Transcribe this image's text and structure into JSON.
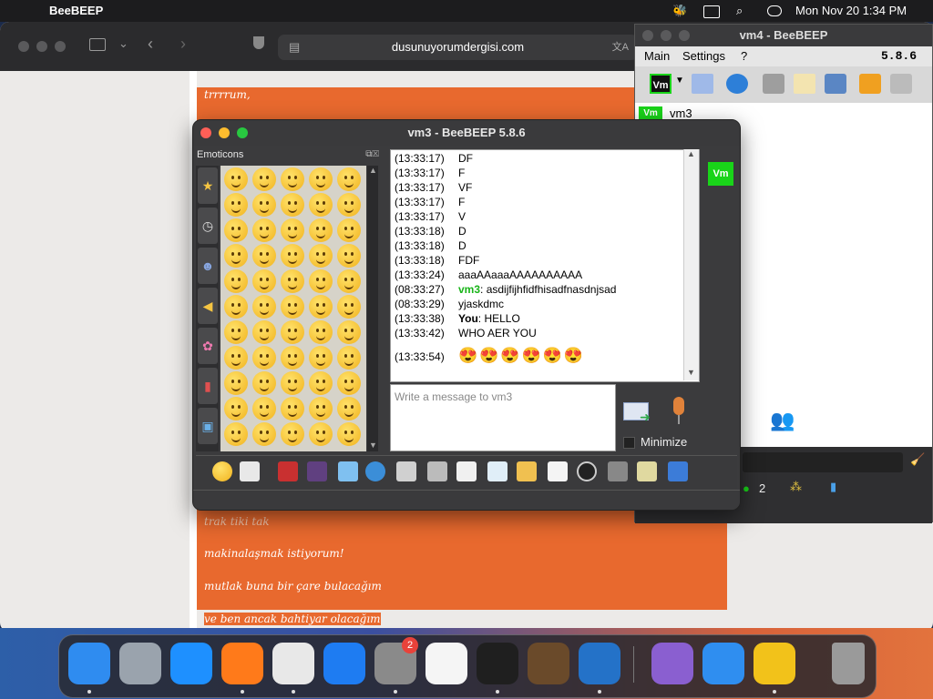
{
  "menubar": {
    "app_name": "BeeBEEP",
    "clock": "Mon Nov 20  1:34 PM"
  },
  "safari": {
    "url": "dusunuyorumdergisi.com",
    "poem_lines": [
      "trrrrum,",
      "trak tiki tak",
      "makinalaşmak istiyorum!",
      "mutlak buna bir çare bulacağım",
      "ve ben ancak bahtiyar olacağım"
    ]
  },
  "vm4": {
    "title": "vm4 - BeeBEEP",
    "menu": [
      "Main",
      "Settings",
      "?"
    ],
    "version": "5.8.6",
    "user": "vm3",
    "user_badge": "Vm",
    "toolbar_badge": "Vm",
    "status_count": "2"
  },
  "vm3": {
    "title": "vm3 - BeeBEEP 5.8.6",
    "emoticons_title": "Emoticons",
    "user_badge": "Vm",
    "chat": [
      {
        "time": "(13:33:17)",
        "text": "DF"
      },
      {
        "time": "(13:33:17)",
        "text": "F"
      },
      {
        "time": "(13:33:17)",
        "text": "VF"
      },
      {
        "time": "(13:33:17)",
        "text": "F"
      },
      {
        "time": "(13:33:17)",
        "text": "V"
      },
      {
        "time": "(13:33:18)",
        "text": "D"
      },
      {
        "time": "(13:33:18)",
        "text": "D"
      },
      {
        "time": "(13:33:18)",
        "text": "FDF"
      },
      {
        "time": "(13:33:24)",
        "text": "aaaAAaaaAAAAAAAAAA"
      },
      {
        "time": "(08:33:27)",
        "sender": "vm3",
        "text": ": asdijfijhfidfhisadfnasdnjsad"
      },
      {
        "time": "(08:33:29)",
        "text": "yjaskdmc"
      },
      {
        "time": "(13:33:38)",
        "sender": "You",
        "text": ": HELLO"
      },
      {
        "time": "(13:33:42)",
        "text": "WHO AER YOU"
      },
      {
        "time": "(13:33:54)",
        "emoji": "😍😍😍😍😍😍"
      }
    ],
    "input_placeholder": "Write a message to vm3",
    "minimize_label": "Minimize"
  },
  "dock": {
    "apps": [
      "Finder",
      "Launchpad",
      "Safari",
      "Firefox",
      "Chrome",
      "App Store",
      "System Settings",
      "TextEdit",
      "Terminal",
      "GarageBand",
      "VS Code",
      "Visual Studio",
      "Weather",
      "BeeBEEP",
      "Trash"
    ],
    "settings_badge": "2"
  }
}
